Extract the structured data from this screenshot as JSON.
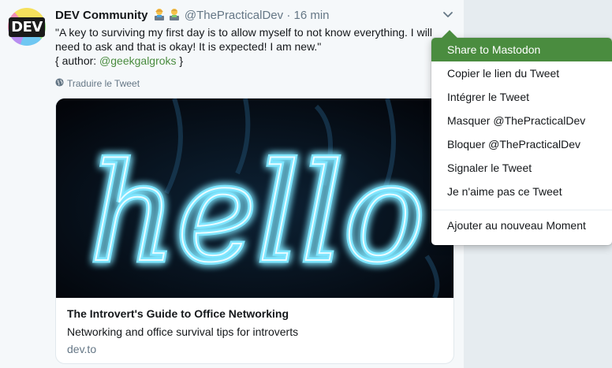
{
  "tweet": {
    "name": "DEV Community",
    "handle": "@ThePracticalDev",
    "separator": "·",
    "time": "16 min",
    "line1": "\"A key to surviving my first day is to allow myself to not know everything. I will",
    "line2": "need to ask and that is okay! It is expected! I am new.\"",
    "author_prefix": "{ author: ",
    "author_mention": "@geekgalgroks",
    "author_suffix": " }",
    "translate": "Traduire le Tweet",
    "avatar_text": "DEV"
  },
  "card": {
    "image_word": "hello",
    "title": "The Introvert's Guide to Office Networking",
    "description": "Networking and office survival tips for introverts",
    "domain": "dev.to"
  },
  "menu": {
    "items": [
      {
        "label": "Share to Mastodon"
      },
      {
        "label": "Copier le lien du Tweet"
      },
      {
        "label": "Intégrer le Tweet"
      },
      {
        "label": "Masquer @ThePracticalDev"
      },
      {
        "label": "Bloquer @ThePracticalDev"
      },
      {
        "label": "Signaler le Tweet"
      },
      {
        "label": "Je n'aime pas ce Tweet"
      },
      {
        "label": "Ajouter au nouveau Moment"
      }
    ]
  },
  "colors": {
    "accent": "#4a8c3f",
    "neon": "#7fe6ff",
    "muted": "#657786",
    "background": "#f5f8fa"
  }
}
